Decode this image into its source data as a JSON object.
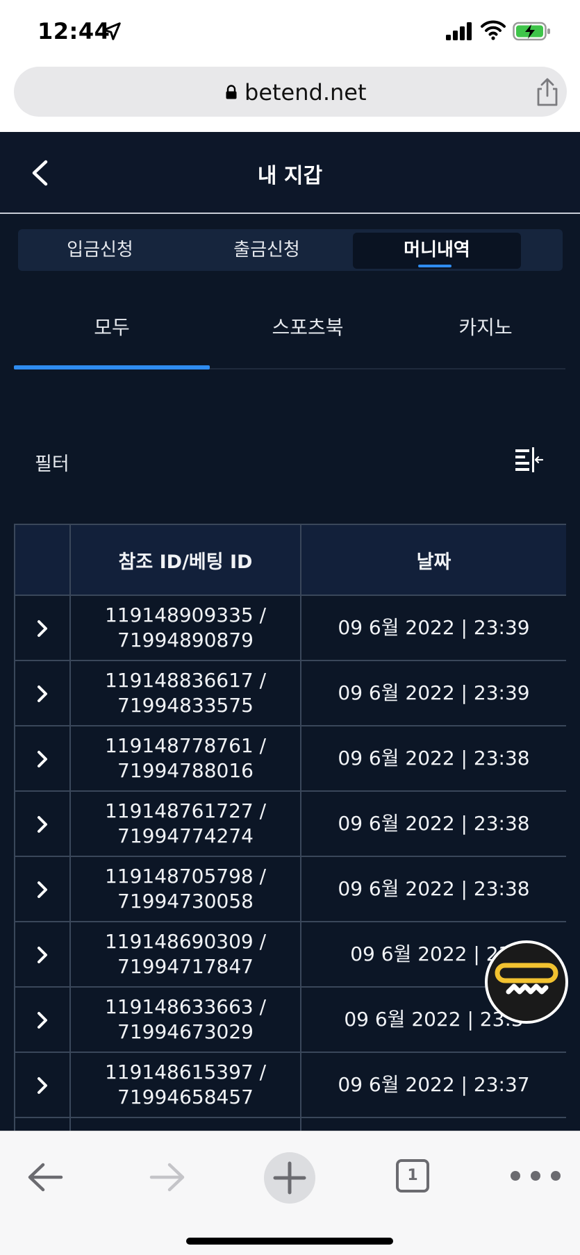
{
  "status_bar": {
    "time": "12:44"
  },
  "browser": {
    "url": "betend.net",
    "tab_count": "1"
  },
  "header": {
    "title": "내 지갑"
  },
  "segmented_tabs": [
    {
      "label": "입금신청",
      "active": false
    },
    {
      "label": "출금신청",
      "active": false
    },
    {
      "label": "머니내역",
      "active": true
    }
  ],
  "sub_tabs": [
    {
      "label": "모두",
      "active": true
    },
    {
      "label": "스포츠북",
      "active": false
    },
    {
      "label": "카지노",
      "active": false
    }
  ],
  "filter": {
    "label": "필터"
  },
  "table": {
    "columns": [
      "",
      "참조 ID/베팅 ID",
      "날짜"
    ],
    "rows": [
      {
        "ref": "119148909335 /",
        "bet": "71994890879",
        "date": "09 6월 2022 | 23:39"
      },
      {
        "ref": "119148836617 /",
        "bet": "71994833575",
        "date": "09 6월 2022 | 23:39"
      },
      {
        "ref": "119148778761 /",
        "bet": "71994788016",
        "date": "09 6월 2022 | 23:38"
      },
      {
        "ref": "119148761727 /",
        "bet": "71994774274",
        "date": "09 6월 2022 | 23:38"
      },
      {
        "ref": "119148705798 /",
        "bet": "71994730058",
        "date": "09 6월 2022 | 23:38"
      },
      {
        "ref": "119148690309 /",
        "bet": "71994717847",
        "date": "09 6월 2022 | 23:"
      },
      {
        "ref": "119148633663 /",
        "bet": "71994673029",
        "date": "09 6월 2022 | 23:3"
      },
      {
        "ref": "119148615397 /",
        "bet": "71994658457",
        "date": "09 6월 2022 | 23:37"
      },
      {
        "ref": "",
        "bet": "",
        "date": ""
      }
    ]
  },
  "colors": {
    "background": "#0c1626",
    "accent": "#2f8cf0",
    "fab_yellow": "#f2c230"
  }
}
